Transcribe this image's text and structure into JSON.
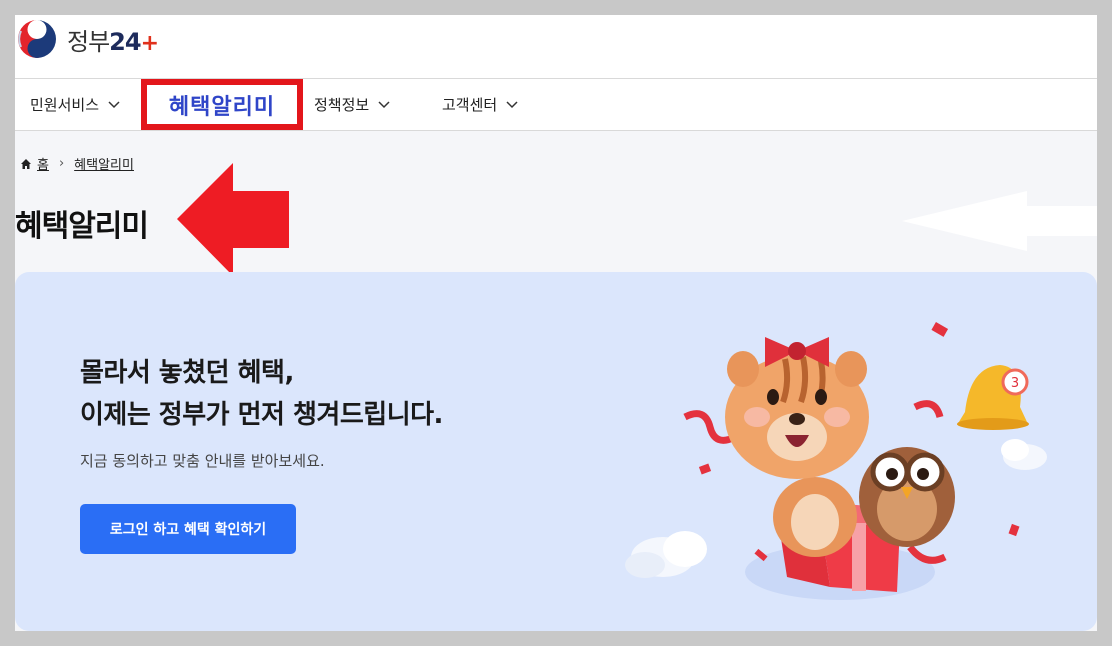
{
  "header": {
    "logo_text": "정부",
    "logo_number": "24",
    "logo_plus": "+"
  },
  "nav": {
    "items": [
      {
        "label": "민원서비스"
      },
      {
        "label": "혜택알리미"
      },
      {
        "label": "정책정보"
      },
      {
        "label": "고객센터"
      }
    ]
  },
  "breadcrumb": {
    "home": "홈",
    "current": "혜택알리미"
  },
  "page": {
    "title": "혜택알리미"
  },
  "banner": {
    "headline_line1": "몰라서 놓쳤던 혜택,",
    "headline_line2": "이제는 정부가 먼저 챙겨드립니다.",
    "subtitle": "지금 동의하고 맞춤 안내를 받아보세요.",
    "cta_label": "로그인 하고 혜택 확인하기",
    "bell_badge": "3"
  },
  "colors": {
    "accent": "#2a6ef5",
    "highlight_border": "#e3161b",
    "highlight_text": "#2f45c8",
    "banner_bg": "#dbe6fc"
  },
  "icons": [
    "gov-logo-icon",
    "chevron-down-icon",
    "home-icon",
    "chevron-right-icon",
    "red-arrow-icon",
    "white-arrow-icon"
  ]
}
